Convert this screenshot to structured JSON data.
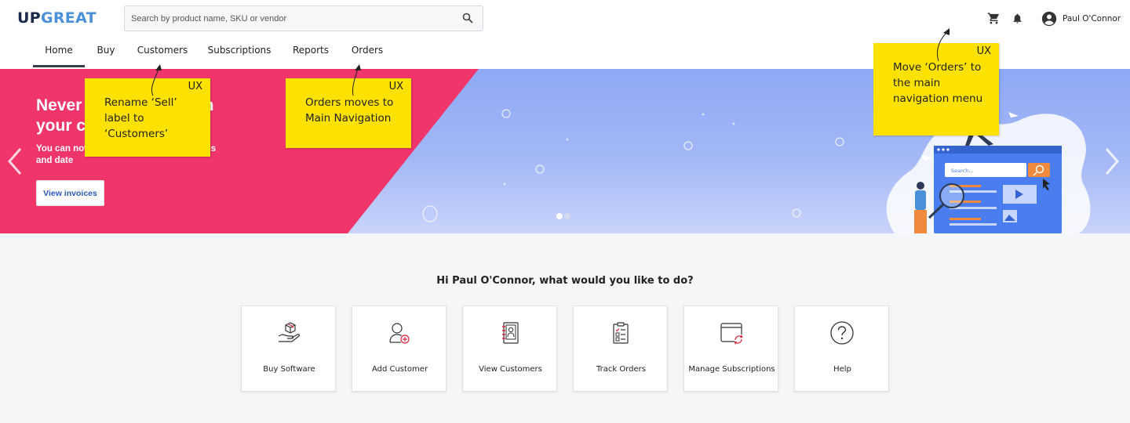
{
  "header": {
    "logo_up": "UP",
    "logo_great": "GREAT",
    "search_placeholder": "Search by product name, SKU or vendor",
    "user_name": "Paul O'Connor"
  },
  "nav": {
    "tabs": [
      {
        "label": "Home",
        "active": true
      },
      {
        "label": "Buy"
      },
      {
        "label": "Customers"
      },
      {
        "label": "Subscriptions"
      },
      {
        "label": "Reports"
      },
      {
        "label": "Orders"
      }
    ]
  },
  "hero": {
    "title": "Never miss a beat with your customers",
    "subtitle": "You can now filter your invoices by status and date",
    "button_label": "View invoices",
    "illustration_search_text": "Search...",
    "slide_count": 2,
    "active_slide": 1
  },
  "annotations": [
    {
      "tag": "UX",
      "text": "Rename ‘Sell’ label to ‘Customers’"
    },
    {
      "tag": "UX",
      "text": "Orders moves to Main Navigation"
    },
    {
      "tag": "UX",
      "text": "Move ‘Orders’ to the main navigation menu"
    }
  ],
  "main": {
    "greeting": "Hi Paul O'Connor, what would you like to do?",
    "cards": [
      {
        "label": "Buy Software",
        "icon": "buy-software-icon"
      },
      {
        "label": "Add Customer",
        "icon": "add-customer-icon"
      },
      {
        "label": "View Customers",
        "icon": "view-customers-icon"
      },
      {
        "label": "Track Orders",
        "icon": "track-orders-icon"
      },
      {
        "label": "Manage Subscriptions",
        "icon": "manage-subscriptions-icon"
      },
      {
        "label": "Help",
        "icon": "help-icon"
      }
    ]
  },
  "colors": {
    "brand_dark": "#1c2a4a",
    "brand_blue": "#4a90d9",
    "hero_pink": "#f0356a",
    "hero_blue": "#8ea8f5",
    "note_yellow": "#fde100",
    "icon_accent": "#d9253a"
  }
}
